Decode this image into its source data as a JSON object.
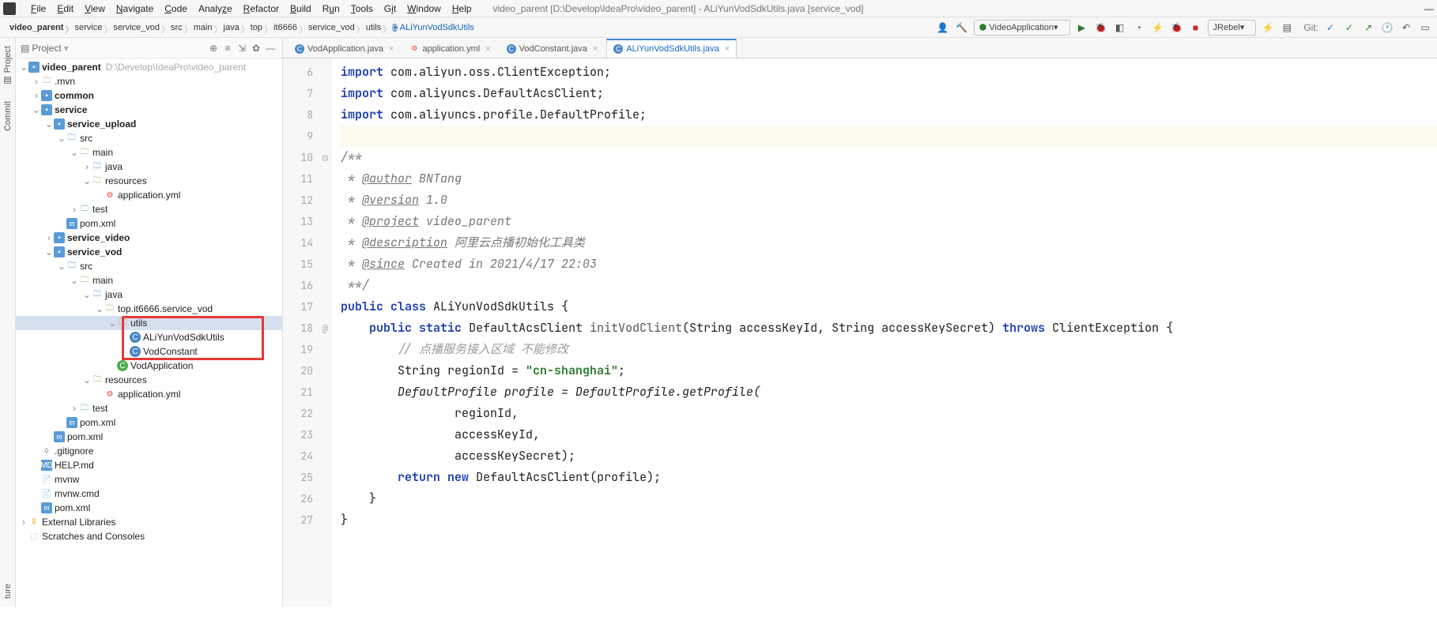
{
  "window": {
    "title": "video_parent [D:\\Develop\\IdeaPro\\video_parent] - ALiYunVodSdkUtils.java [service_vod]"
  },
  "menu": {
    "file": "File",
    "edit": "Edit",
    "view": "View",
    "navigate": "Navigate",
    "code": "Code",
    "analyze": "Analyze",
    "refactor": "Refactor",
    "build": "Build",
    "run": "Run",
    "tools": "Tools",
    "git": "Git",
    "window": "Window",
    "help": "Help"
  },
  "breadcrumbs": [
    "video_parent",
    "service",
    "service_vod",
    "src",
    "main",
    "java",
    "top",
    "it6666",
    "service_vod",
    "utils",
    "ALiYunVodSdkUtils"
  ],
  "toolbar": {
    "run_config": "VideoApplication",
    "jrebel": "JRebel",
    "git_label": "Git:"
  },
  "project_panel": {
    "title": "Project"
  },
  "tree": {
    "root": {
      "name": "video_parent",
      "path": "D:\\Develop\\IdeaPro\\video_parent"
    },
    "mvn": ".mvn",
    "common": "common",
    "service": "service",
    "service_upload": "service_upload",
    "src1": "src",
    "main1": "main",
    "java1": "java",
    "resources1": "resources",
    "app_yml1": "application.yml",
    "test1": "test",
    "pom1": "pom.xml",
    "service_video": "service_video",
    "service_vod": "service_vod",
    "src2": "src",
    "main2": "main",
    "java2": "java",
    "pkg": "top.it6666.service_vod",
    "utils": "utils",
    "cls1": "ALiYunVodSdkUtils",
    "cls2": "VodConstant",
    "cls3": "VodApplication",
    "resources2": "resources",
    "app_yml2": "application.yml",
    "test2": "test",
    "pom2": "pom.xml",
    "pom3": "pom.xml",
    "gitignore": ".gitignore",
    "help": "HELP.md",
    "mvnw": "mvnw",
    "mvnwcmd": "mvnw.cmd",
    "pom4": "pom.xml",
    "extlib": "External Libraries",
    "scratch": "Scratches and Consoles"
  },
  "tabs": [
    {
      "name": "VodApplication.java",
      "icon": "class"
    },
    {
      "name": "application.yml",
      "icon": "yml"
    },
    {
      "name": "VodConstant.java",
      "icon": "class"
    },
    {
      "name": "ALiYunVodSdkUtils.java",
      "icon": "class",
      "active": true
    }
  ],
  "code": {
    "l6": {
      "kw": "import",
      "rest": " com.aliyun.oss.ClientException;"
    },
    "l7": {
      "kw": "import",
      "rest": " com.aliyuncs.DefaultAcsClient;"
    },
    "l8": {
      "kw": "import",
      "rest": " com.aliyuncs.profile.DefaultProfile;"
    },
    "l10": "/**",
    "l11": {
      "pre": " * ",
      "ann": "@author",
      "rest": " BNTang"
    },
    "l12": {
      "pre": " * ",
      "ann": "@version",
      "rest": " 1.0"
    },
    "l13": {
      "pre": " * ",
      "ann": "@project",
      "rest": " video_parent"
    },
    "l14": {
      "pre": " * ",
      "ann": "@description",
      "rest": " 阿里云点播初始化工具类"
    },
    "l15": {
      "pre": " * ",
      "ann": "@since",
      "rest": " Created in 2021/4/17 22:03"
    },
    "l16": " **/",
    "l17": {
      "pub": "public",
      "cls": "class",
      "name": " ALiYunVodSdkUtils {"
    },
    "l18": {
      "pub": "public",
      "stat": "static",
      "ret": " DefaultAcsClient ",
      "meth": "initVodClient",
      "params": "(String accessKeyId, String accessKeySecret) ",
      "thr": "throws",
      "exc": " ClientException {"
    },
    "l19": "// 点播服务接入区域 不能修改",
    "l20": {
      "a": "String regionId = ",
      "str": "\"cn-shanghai\"",
      "b": ";"
    },
    "l21": "DefaultProfile profile = DefaultProfile.getProfile(",
    "l22": "regionId,",
    "l23": "accessKeyId,",
    "l24": "accessKeySecret);",
    "l25": {
      "ret": "return",
      "nw": "new",
      "rest": " DefaultAcsClient(profile);"
    },
    "l26": "}",
    "l27": "}"
  },
  "line_numbers": [
    "6",
    "7",
    "8",
    "9",
    "10",
    "11",
    "12",
    "13",
    "14",
    "15",
    "16",
    "17",
    "18",
    "19",
    "20",
    "21",
    "22",
    "23",
    "24",
    "25",
    "26",
    "27"
  ],
  "side": {
    "project": "Project",
    "commit": "Commit",
    "structure": "ture"
  }
}
